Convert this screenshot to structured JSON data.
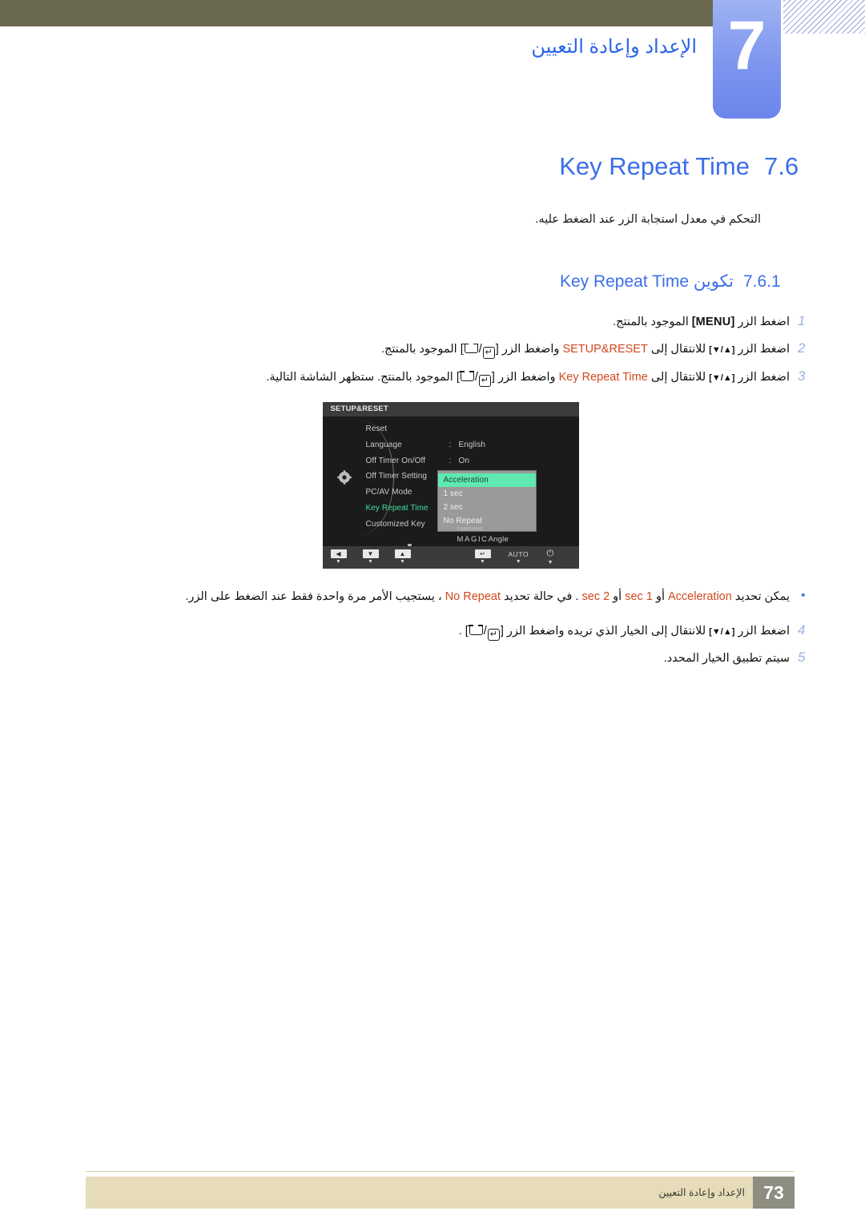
{
  "chapter": {
    "number": "7",
    "title": "الإعداد وإعادة التعيين"
  },
  "section": {
    "number": "7.6",
    "title": "Key Repeat Time",
    "description": "التحكم في معدل استجابة الزر عند الضغط عليه."
  },
  "subsection": {
    "number": "7.6.1",
    "title": "تكوين Key Repeat Time"
  },
  "steps": [
    {
      "num": "1",
      "prefix": "اضغط الزر",
      "key": "[MENU]",
      "suffix": "الموجود بالمنتج."
    },
    {
      "num": "2",
      "seg1": "اضغط الزر",
      "key1": "[▲/▼]",
      "seg2": "للانتقال إلى",
      "target": "SETUP&RESET",
      "seg3": "واضغط الزر",
      "seg4": "الموجود بالمنتج."
    },
    {
      "num": "3",
      "seg1": "اضغط الزر",
      "key1": "[▲/▼]",
      "seg2": "للانتقال إلى",
      "target": "Key Repeat Time",
      "seg3": "واضغط الزر",
      "seg4": "الموجود بالمنتج. ستظهر الشاشة التالية."
    },
    {
      "num": "4",
      "seg1": "اضغط الزر",
      "key1": "[▲/▼]",
      "seg2": "للانتقال إلى الخيار الذي تريده واضغط الزر",
      "seg4": "."
    },
    {
      "num": "5",
      "text": "سيتم تطبيق الخيار المحدد."
    }
  ],
  "note": {
    "bullet": "•",
    "seg1": "يمكن تحديد",
    "opt1": "Acceleration",
    "seg2": "أو",
    "opt2": "1 sec",
    "seg3": "أو",
    "opt3": "2 sec",
    "seg4": ". في حالة تحديد",
    "opt4": "No Repeat",
    "seg5": "، يستجيب الأمر مرة واحدة فقط عند الضغط على الزر."
  },
  "osd": {
    "title": "SETUP&RESET",
    "rows": [
      {
        "label": "Reset",
        "colon": "",
        "value": "",
        "active": false
      },
      {
        "label": "Language",
        "colon": ":",
        "value": "English",
        "active": false
      },
      {
        "label": "Off Timer On/Off",
        "colon": ":",
        "value": "On",
        "active": false
      },
      {
        "label": "Off Timer Setting",
        "colon": ":",
        "value": "",
        "active": false
      },
      {
        "label": "PC/AV Mode",
        "colon": "",
        "value": "",
        "active": false
      },
      {
        "label": "Key Repeat Time",
        "colon": ":",
        "value": "",
        "active": true
      },
      {
        "label": "Customized Key",
        "colon": ":",
        "value": "",
        "active": false
      }
    ],
    "dropdown": {
      "items": [
        "Acceleration",
        "1 sec",
        "2 sec",
        "No Repeat"
      ],
      "selected": "Acceleration"
    },
    "magic": {
      "small": "SAMSUNG",
      "large": "MAGIC",
      "suffix": "Angle"
    },
    "scroll_down_icon": "▼",
    "bottom_buttons": [
      {
        "name": "left-arrow",
        "glyph": "◀",
        "sub": "▼"
      },
      {
        "name": "down-arrow",
        "glyph": "▼",
        "sub": "▼"
      },
      {
        "name": "up-arrow",
        "glyph": "▲",
        "sub": "▼"
      },
      {
        "name": "enter",
        "glyph": "↵",
        "sub": "▼"
      },
      {
        "name": "auto",
        "glyph": "AUTO",
        "sub": "▼"
      },
      {
        "name": "power",
        "glyph": "⏻",
        "sub": "▼"
      }
    ]
  },
  "footer": {
    "page": "73",
    "text": "الإعداد وإعادة التعيين"
  },
  "colors": {
    "accent_blue": "#3b6fe8",
    "highlight_orange": "#d2481c",
    "osd_green": "#3fe0a0",
    "header_olive": "#6b6850",
    "footer_beige": "#e6dcba"
  }
}
